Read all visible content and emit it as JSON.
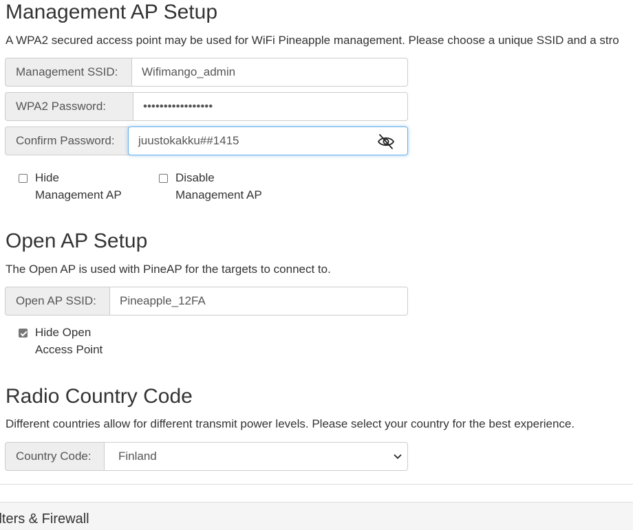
{
  "management": {
    "heading": "Management AP Setup",
    "description": "A WPA2 secured access point may be used for WiFi Pineapple management. Please choose a unique SSID and a stro",
    "ssid_label": "Management SSID:",
    "ssid_value": "Wifimango_admin",
    "password_label": "WPA2 Password:",
    "password_value": "•••••••••••••••••",
    "confirm_label": "Confirm Password:",
    "confirm_value": "juustokakku##1415",
    "hide_ap": {
      "label_line1": "Hide",
      "label_line2": "Management AP",
      "checked": false
    },
    "disable_ap": {
      "label_line1": "Disable",
      "label_line2": "Management AP",
      "checked": false
    }
  },
  "open_ap": {
    "heading": "Open AP Setup",
    "description": "The Open AP is used with PineAP for the targets to connect to.",
    "ssid_label": "Open AP SSID:",
    "ssid_value": "Pineapple_12FA",
    "hide_open": {
      "label_line1": "Hide Open",
      "label_line2": "Access Point",
      "checked": true
    }
  },
  "country": {
    "heading": "Radio Country Code",
    "description": "Different countries allow for different transmit power levels. Please select your country for the best experience.",
    "label": "Country Code:",
    "selected": "Finland"
  },
  "next_panel": {
    "title": "ilters & Firewall"
  },
  "icons": {
    "password_toggle": "eye-slash-icon",
    "select_arrow": "chevron-down-icon"
  },
  "colors": {
    "focus_border": "#66afe9",
    "addon_bg": "#eeeeee",
    "panel_bg": "#f5f5f5"
  }
}
